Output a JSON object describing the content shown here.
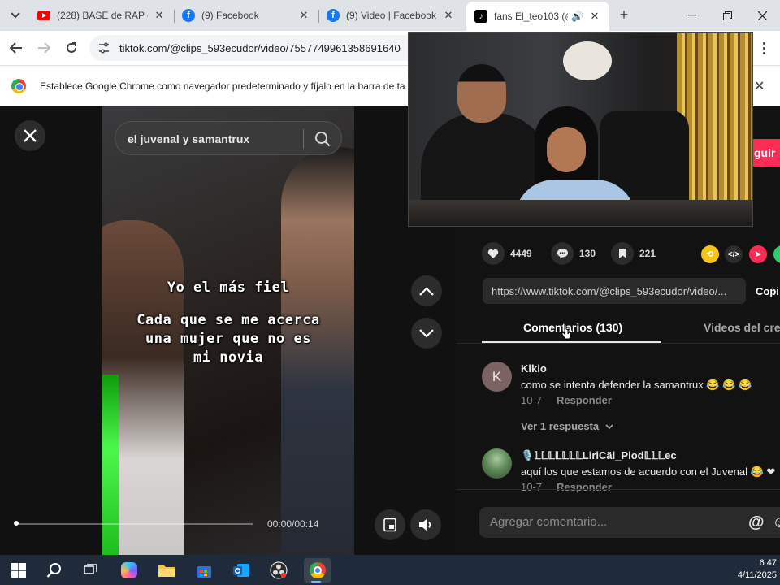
{
  "browser": {
    "tabs": [
      {
        "title": "(228) BASE de RAP con",
        "favicon": "youtube-icon"
      },
      {
        "title": "(9) Facebook",
        "favicon": "facebook-icon"
      },
      {
        "title": "(9) Video | Facebook",
        "favicon": "facebook-icon"
      },
      {
        "title": "fans El_teo103 (@c",
        "favicon": "tiktok-icon",
        "active": true
      }
    ],
    "url": "tiktok.com/@clips_593ecudor/video/7557749961358691640",
    "infobar_text": "Establece Google Chrome como navegador predeterminado y fíjalo en la barra de ta"
  },
  "video": {
    "search_query": "el juvenal y samantrux",
    "caption_line1": "Yo el más fiel",
    "caption_lines": [
      "Cada que se me acerca",
      "una mujer que no es",
      "mi novia"
    ],
    "time": "00:00/00:14",
    "progress": 0.0
  },
  "panel": {
    "follow_label": "guir",
    "stats": {
      "likes": "4449",
      "comments": "130",
      "saves": "221"
    },
    "link": "https://www.tiktok.com/@clips_593ecudor/video/...",
    "copy_label": "Copi",
    "tabs": {
      "comments": "Comentarios (130)",
      "creator_videos": "Videos del crea"
    },
    "comments": [
      {
        "avatar_letter": "K",
        "user": "Kikio",
        "text": "como se intenta defender la samantrux 😂 😂 😂",
        "date": "10-7",
        "reply_label": "Responder",
        "more_replies": "Ver 1 respuesta"
      },
      {
        "user": "🎙️𝕃𝕃𝕃𝕃𝕃𝕃𝕃LiriCäl_Plod𝕃𝕃𝕃ec",
        "text": "aquí los que estamos de acuerdo con el Juvenal 😂 ❤",
        "date": "10-7",
        "reply_label": "Responder"
      }
    ],
    "comment_placeholder": "Agregar comentario..."
  },
  "taskbar": {
    "time": "6:47",
    "date": "4/11/2025"
  },
  "colors": {
    "accent_red": "#fe2c55",
    "dark_bg": "#121212"
  }
}
